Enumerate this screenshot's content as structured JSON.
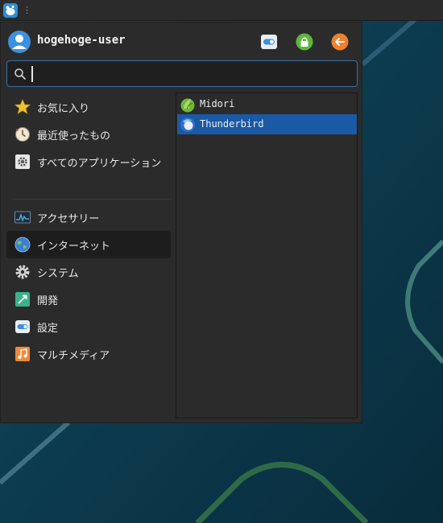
{
  "user": {
    "name": "hogehoge-user"
  },
  "search": {
    "value": "",
    "placeholder": ""
  },
  "categories": [
    {
      "label": "お気に入り",
      "icon": "star-icon"
    },
    {
      "label": "最近使ったもの",
      "icon": "recent-clock-icon"
    },
    {
      "label": "すべてのアプリケーション",
      "icon": "all-apps-icon"
    },
    {
      "label": "アクセサリー",
      "icon": "accessories-icon"
    },
    {
      "label": "インターネット",
      "icon": "globe-icon",
      "selected": true
    },
    {
      "label": "システム",
      "icon": "gear-icon"
    },
    {
      "label": "開発",
      "icon": "development-icon"
    },
    {
      "label": "設定",
      "icon": "settings-toggle-icon"
    },
    {
      "label": "マルチメディア",
      "icon": "music-note-icon"
    }
  ],
  "apps": [
    {
      "label": "Midori",
      "icon": "midori-icon"
    },
    {
      "label": "Thunderbird",
      "icon": "thunderbird-icon",
      "selected": true
    }
  ],
  "colors": {
    "selection": "#1a59a6",
    "menu_bg": "#2b2b2b",
    "lock_green": "#5fb83a",
    "logout_orange": "#f0802e",
    "search_border": "#3a6ea5"
  }
}
